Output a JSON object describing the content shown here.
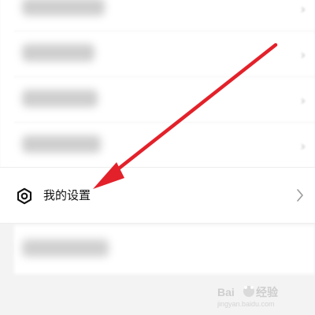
{
  "settings_row": {
    "label": "我的设置",
    "icon": "settings-hexagon-icon",
    "chevron_icon": "chevron-right-icon"
  },
  "annotation": {
    "arrow_color": "#e3212a"
  },
  "watermark": {
    "text": "Baidu经验",
    "url_text": "jingyan.baidu.com"
  },
  "colors": {
    "background": "#f3f3f3",
    "row_bg": "#ffffff",
    "text": "#111111",
    "chevron": "#9b9b9b"
  }
}
